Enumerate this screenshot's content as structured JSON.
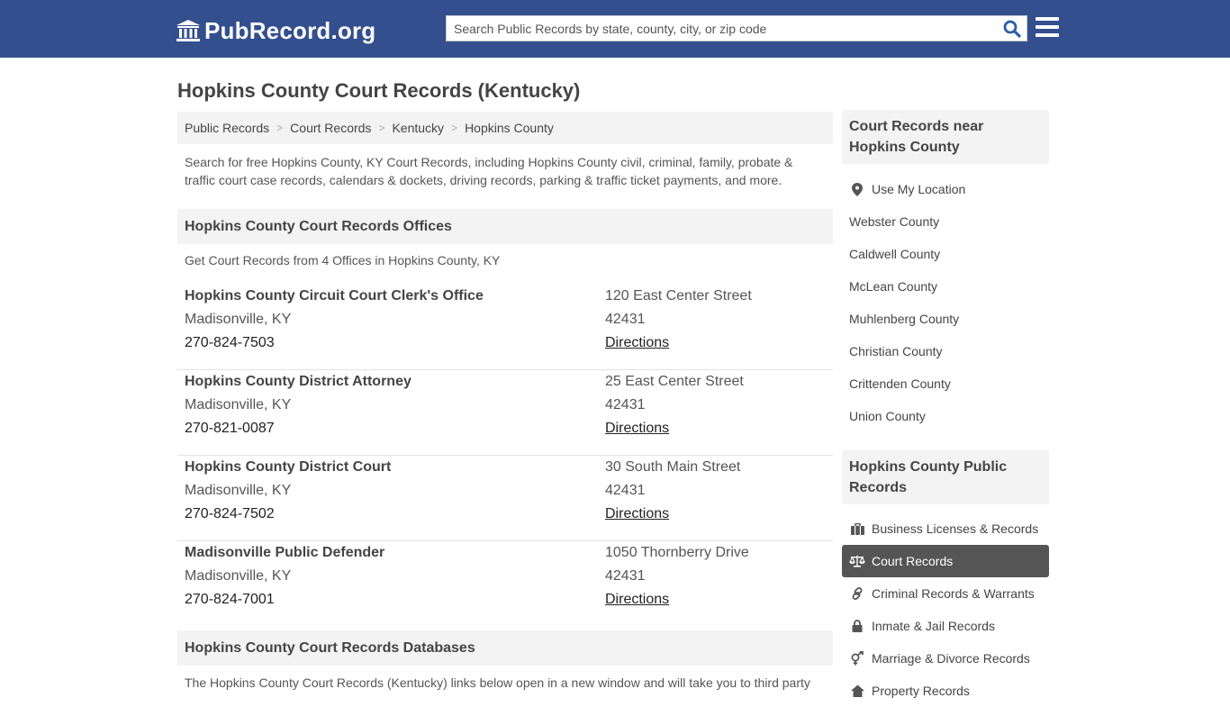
{
  "header": {
    "logo_text": "PubRecord.org",
    "search_placeholder": "Search Public Records by state, county, city, or zip code"
  },
  "page": {
    "title": "Hopkins County Court Records (Kentucky)",
    "breadcrumb": [
      "Public Records",
      "Court Records",
      "Kentucky",
      "Hopkins County"
    ],
    "intro": "Search for free Hopkins County, KY Court Records, including Hopkins County civil, criminal, family, probate & traffic court case records, calendars & dockets, driving records, parking & traffic ticket payments, and more."
  },
  "offices": {
    "heading": "Hopkins County Court Records Offices",
    "subtitle": "Get Court Records from 4 Offices in Hopkins County, KY",
    "items": [
      {
        "name": "Hopkins County Circuit Court Clerk's Office",
        "city": "Madisonville, KY",
        "phone": "270-824-7503",
        "address": "120 East Center Street",
        "zip": "42431",
        "link": "Directions"
      },
      {
        "name": "Hopkins County District Attorney",
        "city": "Madisonville, KY",
        "phone": "270-821-0087",
        "address": "25 East Center Street",
        "zip": "42431",
        "link": "Directions"
      },
      {
        "name": "Hopkins County District Court",
        "city": "Madisonville, KY",
        "phone": "270-824-7502",
        "address": "30 South Main Street",
        "zip": "42431",
        "link": "Directions"
      },
      {
        "name": "Madisonville Public Defender",
        "city": "Madisonville, KY",
        "phone": "270-824-7001",
        "address": "1050 Thornberry Drive",
        "zip": "42431",
        "link": "Directions"
      }
    ]
  },
  "databases": {
    "heading": "Hopkins County Court Records Databases",
    "text": "The Hopkins County Court Records (Kentucky) links below open in a new window and will take you to third party"
  },
  "sidebar": {
    "nearby": {
      "heading": "Court Records near Hopkins County",
      "location_label": "Use My Location",
      "counties": [
        "Webster County",
        "Caldwell County",
        "McLean County",
        "Muhlenberg County",
        "Christian County",
        "Crittenden County",
        "Union County"
      ]
    },
    "public_records": {
      "heading": "Hopkins County Public Records",
      "items": [
        {
          "label": "Business Licenses & Records",
          "icon": "briefcase-icon"
        },
        {
          "label": "Court Records",
          "icon": "scale-icon",
          "active": true
        },
        {
          "label": "Criminal Records & Warrants",
          "icon": "link-icon"
        },
        {
          "label": "Inmate & Jail Records",
          "icon": "lock-icon"
        },
        {
          "label": "Marriage & Divorce Records",
          "icon": "gender-icon"
        },
        {
          "label": "Property Records",
          "icon": "home-icon"
        }
      ]
    }
  },
  "colors": {
    "header_bg": "#334f8e",
    "search_icon": "#2b5ea8",
    "active_item_bg": "#555555"
  }
}
